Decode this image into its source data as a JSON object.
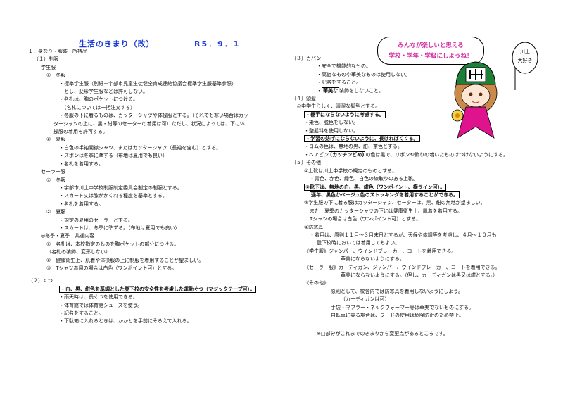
{
  "title": "生活のきまり（改）",
  "date": "R5．9．1",
  "bubble": {
    "line1": "みんなが楽しいと思える",
    "line2": "学校・学年・学級にしようね！"
  },
  "sign_text": "川上大好き",
  "left": {
    "s1": "１．身なり・服装・所持品",
    "s1_1": "（１）制服",
    "boys": "学生服",
    "boys_w": "①　冬服",
    "l1": "・標準学生服（別紙－宇部市児童生徒健全育成連絡協議会標準学生服基準参照）",
    "l2": "　とし、変形学生服などは許可しない。",
    "l3": "・名札は、胸のポケットにつける。",
    "l4": "　（名札については一括注文する）",
    "l5": "・冬服の下に着るものは、カッターシャツや体操服とする。（それでも寒い場合はカッ",
    "l6": "ターシャツの上に、黒・紺等のセーターの着用は可）ただし、状況によっては、下に体",
    "l7": "操服の着用を許可する。",
    "boys_s": "②　夏服",
    "l8": "・白色の半袖開襟シャツ、またはカッターシャツ（長袖を含む）とする。",
    "l9": "・ズボンは冬季に準ずる（布地は夏用でも良い）",
    "l10": "・名札を着用する。",
    "girls": "セーラー服",
    "girls_w": "①　冬服",
    "g1": "・宇部市川上中学校制服制定委員会制定の制服とする。",
    "g2": "・スカート丈は膝がかくれる程度を基準とする。",
    "g3": "・名札を着用する。",
    "girls_s": "②　夏服",
    "g4": "・規定の夏用のセーラーとする。",
    "g5": "・スカートは、冬季に準ずる。（布地は夏用でも良い）",
    "common": "◎冬季・夏季　共通内容",
    "c1": "①　名札は、本校指定のものを胸ポケットの部分につける。",
    "c1b": "（名札の装飾、変形しない）",
    "c2": "②　健康衛生上、肌着や体操服の上に制服を着用することが望ましい。",
    "c3": "③　Tシャツ着用の場合は白色（ワンポイント可）とする。",
    "s2": "（２）くつ",
    "k1": "・白、黒、紺色を基調とした登下校の安全性を考慮した運動ぐつ（マジックテープ可）。",
    "k2": "・雨天時は、長ぐつを使用できる。",
    "k3": "・体育館では体育館シューズを使う。",
    "k4": "・記名をすること。",
    "k5": "・下駄箱に入れるときは、かかとを手前にそろえて入れる。"
  },
  "right": {
    "s3": "（３）カバン",
    "b1": "・安全で機能的なもの。",
    "b2": "・高価なものや華美なものは使用しない。",
    "b3": "・記名をすること。",
    "b4a": "華美な",
    "b4b": "装飾をしないこと。",
    "s4": "（４）頭髪",
    "h0": "◎中学生らしく、清潔な髪型とする。",
    "h1": "・極手にならないように考慮する。",
    "h2": "・染色、脱色をしない。",
    "h3": "・整髪料を使用しない。",
    "h4": "・学習の妨げにならないように、長ければくくる。",
    "h5": "・ゴムの色は、無地の黒、紺、茶色とする。",
    "h6a": "・ヘアピン",
    "h6b": "(カッチンどめ)",
    "h6c": "の色は黒で、リボンや飾りの着いたものはつけないようにする。",
    "s5": "（５）その他",
    "o1": "①上靴は川上中学校の規定のものとする。",
    "o1b": "・青色、赤色、緑色、白色の線取りのある上靴。",
    "o2": "②靴下は、無地の白、黒、紺色（ワンポイント、横ライン可）。",
    "o2b": "通年、黒色かベージュ色のストッキングを着用することができる。",
    "o3": "③学生服の下に着る服はカッターシャツ、セーターは、黒、紺の無地が望ましい。",
    "o3b": "また　夏季のカッターシャツの下には健康衛生上、肌着を着用する。",
    "o3c": "Tシャツの場合は白色（ワンポイント可）とする。",
    "o4": "④防寒具",
    "w1": "・着用は、原則１１月～３月末日とするが、天候や体調等を考慮し、４月～１０月も",
    "w2": "登下校時においては着用してもよい。",
    "w3": "《学生服》ジャンパー、ウインドブレーカー、コートを着用できる。",
    "w4": "華美にならないようにする。",
    "w5": "《セーラー服》カーディガン、ジャンパー、ウインドブレーカー、コートを着用できる。",
    "w6": "華美にならないようにする。（但し、カーディガンは黒又は紺とする。）",
    "w7": "《その他》",
    "w8": "原則として、校舎内では防寒具を着用しないようにしよう。",
    "w9": "（カーディガンは可）",
    "w10": "手袋・マフラー・ネックウォーマー等は華美でないものにする。",
    "w11": "自転車に乗る場合は、フードの使用は危険防止のため禁止。"
  },
  "note": "※□部分がこれまでのきまりから変更点があるところです。",
  "colors": {
    "title": "#1a3bd6",
    "bubble_text": "#d42ba0",
    "cape": "#e0138f",
    "helmet": "#1e7f38"
  }
}
